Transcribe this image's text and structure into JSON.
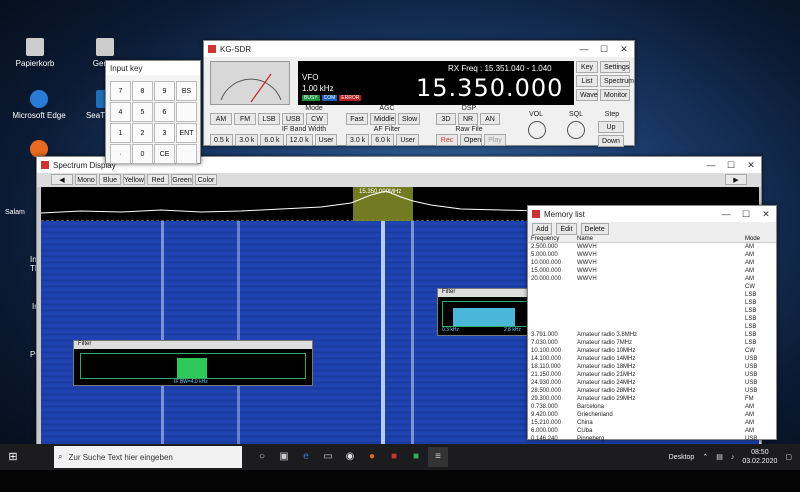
{
  "desktop": {
    "icons": [
      "Papierkorb",
      "Geräte",
      "Microsoft Edge",
      "SeaTTY Fi",
      "Infa Th",
      "Infa",
      "PC-"
    ]
  },
  "sdr": {
    "title": "KG-SDR",
    "vfo_label": "VFO",
    "step": "1.00 kHz",
    "rx_freq": "RX Freq : 15.351.040 - 1.040",
    "freq": "15.350.000",
    "tags": [
      "BUSY",
      "COM",
      "ERROR"
    ],
    "mode_label": "Mode",
    "modes": [
      "AM",
      "FM",
      "LSB",
      "USB",
      "CW"
    ],
    "agc_label": "AGC",
    "agc": [
      "Fast",
      "Middle",
      "Slow"
    ],
    "dsp_label": "DSP",
    "dsp": [
      "3D",
      "NR",
      "AN"
    ],
    "ifbw_label": "IF Band Width",
    "ifbw": [
      "0.5 k",
      "3.0 k",
      "6.0 k",
      "12.0 k",
      "User"
    ],
    "af_label": "AF Filter",
    "af": [
      "3.0 k",
      "6.0 k",
      "User"
    ],
    "raw_label": "Raw File",
    "raw": [
      "Rec",
      "Open",
      "Play"
    ],
    "vol_label": "VOL",
    "sql_label": "SQL",
    "side": [
      "Key",
      "Settings",
      "List",
      "Spectrum",
      "Wave",
      "Monitor"
    ],
    "step_label": "Step",
    "step_btns": [
      "Up",
      "Down"
    ]
  },
  "keypad": {
    "title": "Input key",
    "keys": [
      "7",
      "8",
      "9",
      "BS",
      "4",
      "5",
      "6",
      "",
      "1",
      "2",
      "3",
      "ENT",
      "·",
      "0",
      "CE",
      ""
    ]
  },
  "spectrum": {
    "title": "Spectrum Display",
    "tools": [
      "Mono",
      "Blue",
      "Yellow",
      "Red",
      "Green",
      "Color"
    ],
    "marker": "15.350.000MHz",
    "side_label": "Salam",
    "filter1_title": "Filter",
    "filter1_text": "IF BW=4.0 kHz",
    "filter2_title": "Filter",
    "filter2_left": "0.3 kHz",
    "filter2_right": "2.8 kHz"
  },
  "memory": {
    "title": "Memory list",
    "tools": [
      "Add",
      "Edit",
      "Delete"
    ],
    "columns": [
      "Frequency",
      "Name",
      "Mode"
    ],
    "rows": [
      [
        "2.500.000",
        "WWVH",
        "AM"
      ],
      [
        "5.000.000",
        "WWVH",
        "AM"
      ],
      [
        "10.000.000",
        "WWVH",
        "AM"
      ],
      [
        "15.000.000",
        "WWVH",
        "AM"
      ],
      [
        "20.000.000",
        "WWVH",
        "AM"
      ],
      [
        "",
        "",
        "CW"
      ],
      [
        "",
        "",
        "LSB"
      ],
      [
        "",
        "",
        "LSB"
      ],
      [
        "",
        "",
        "LSB"
      ],
      [
        "",
        "",
        "LSB"
      ],
      [
        "",
        "",
        "LSB"
      ],
      [
        "3.791.000",
        "Amateur radio 3.8MHz",
        "LSB"
      ],
      [
        "7.030.000",
        "Amateur radio 7MHz",
        "LSB"
      ],
      [
        "10.100.000",
        "Amateur radio 10MHz",
        "CW"
      ],
      [
        "14.100.000",
        "Amateur radio 14MHz",
        "USB"
      ],
      [
        "18.110.000",
        "Amateur radio 18MHz",
        "USB"
      ],
      [
        "21.150.000",
        "Amateur radio 21MHz",
        "USB"
      ],
      [
        "24.930.000",
        "Amateur radio 24MHz",
        "USB"
      ],
      [
        "28.500.000",
        "Amateur radio 28MHz",
        "USB"
      ],
      [
        "29.300.000",
        "Amateur radio 29MHz",
        "FM"
      ],
      [
        "0.738.000",
        "Barcelona",
        "AM"
      ],
      [
        "9.420.000",
        "Griechenland",
        "AM"
      ],
      [
        "15.210.000",
        "China",
        "AM"
      ],
      [
        "6.000.000",
        "CUba",
        "AM"
      ],
      [
        "0.146.240",
        "Pinneberg",
        "USB"
      ]
    ]
  },
  "taskbar": {
    "search_placeholder": "Zur Suche Text hier eingeben",
    "desktop_label": "Desktop",
    "time": "08:50",
    "date": "03.02.2020"
  }
}
